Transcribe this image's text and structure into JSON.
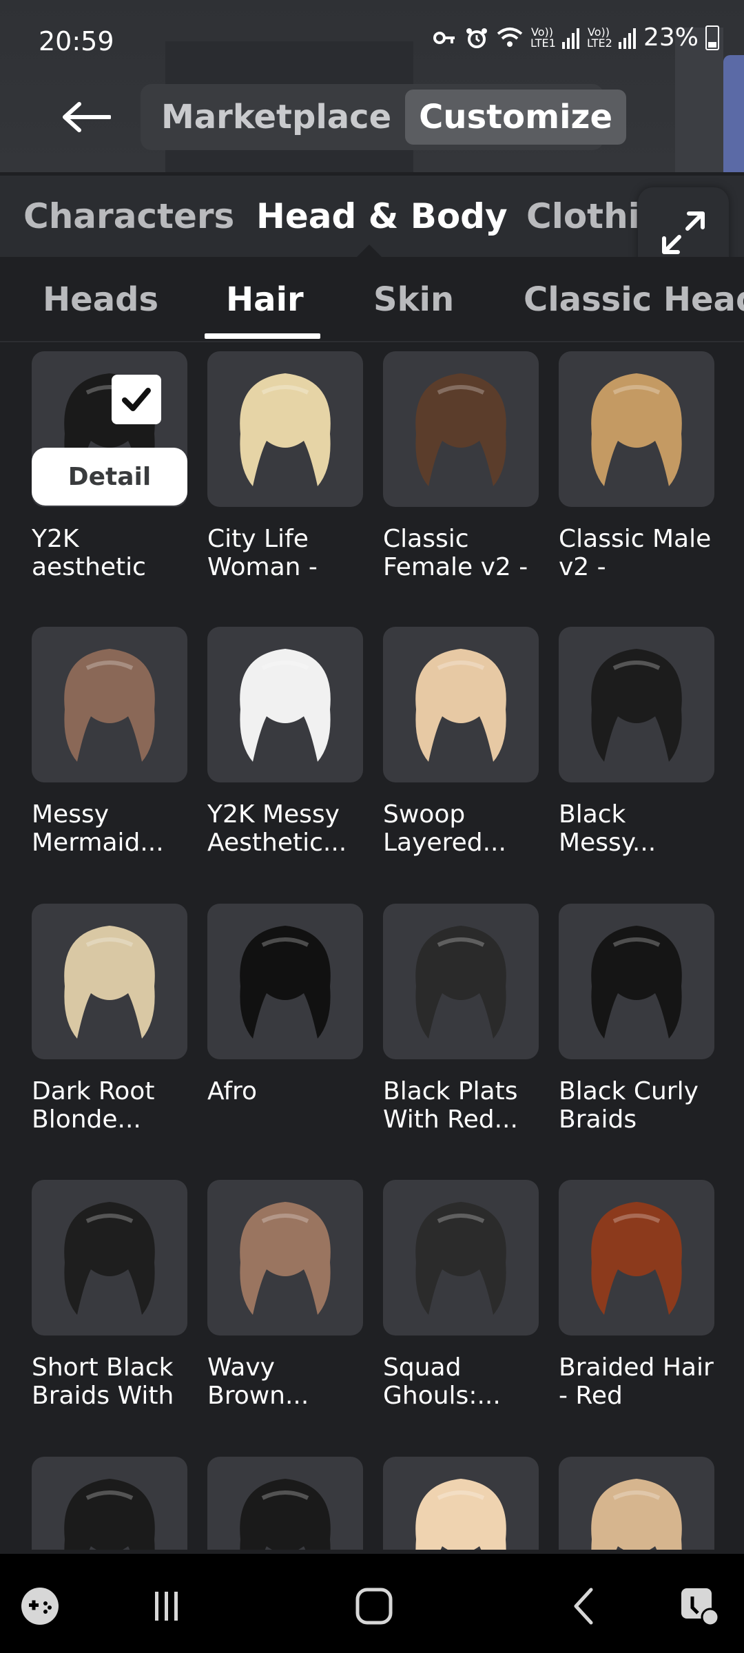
{
  "status_bar": {
    "time": "20:59",
    "sim1": "Vo)) LTE1",
    "sim2": "Vo)) LTE2",
    "battery": "23%"
  },
  "header": {
    "segments": [
      {
        "label": "Marketplace",
        "active": false
      },
      {
        "label": "Customize",
        "active": true
      }
    ]
  },
  "category_tabs": [
    {
      "label": "Characters",
      "active": false
    },
    {
      "label": "Head & Body",
      "active": true
    },
    {
      "label": "Clothing",
      "active": false
    }
  ],
  "sub_tabs": [
    {
      "label": "Heads",
      "active": false
    },
    {
      "label": "Hair",
      "active": true
    },
    {
      "label": "Skin",
      "active": false
    },
    {
      "label": "Classic Heads",
      "active": false
    }
  ],
  "items": [
    {
      "name": "Y2K aesthetic",
      "selected": true,
      "detail_label": "Detail",
      "color": "#1a1a1a"
    },
    {
      "name": "City Life Woman -",
      "color": "#e6d4a6"
    },
    {
      "name": "Classic Female v2 -",
      "color": "#5b3d2b"
    },
    {
      "name": "Classic Male v2 -",
      "color": "#c49a63"
    },
    {
      "name": "Messy Mermaid...",
      "color": "#8a6857"
    },
    {
      "name": "Y2K Messy Aesthetic...",
      "color": "#f1f1f1"
    },
    {
      "name": "Swoop Layered...",
      "color": "#e7c9a4"
    },
    {
      "name": "Black Messy...",
      "color": "#1c1c1c"
    },
    {
      "name": "Dark Root Blonde...",
      "color": "#d9c8a4"
    },
    {
      "name": "Afro",
      "color": "#111111"
    },
    {
      "name": "Black Plats With Red...",
      "color": "#2a2a2a"
    },
    {
      "name": "Black Curly Braids",
      "color": "#151515"
    },
    {
      "name": "Short Black Braids With",
      "color": "#1e1e1e"
    },
    {
      "name": "Wavy Brown...",
      "color": "#9a7560"
    },
    {
      "name": "Squad Ghouls:...",
      "color": "#2b2b2b"
    },
    {
      "name": "Braided Hair - Red",
      "color": "#8c3a1c"
    },
    {
      "name": "",
      "color": "#1b1b1b"
    },
    {
      "name": "",
      "color": "#1a1a1a"
    },
    {
      "name": "",
      "color": "#efd3b0"
    },
    {
      "name": "",
      "color": "#d6b58e"
    }
  ],
  "nav_bar": {
    "icons": [
      "game-controller-icon",
      "recent-apps-icon",
      "home-icon",
      "back-icon",
      "accessibility-icon"
    ]
  }
}
